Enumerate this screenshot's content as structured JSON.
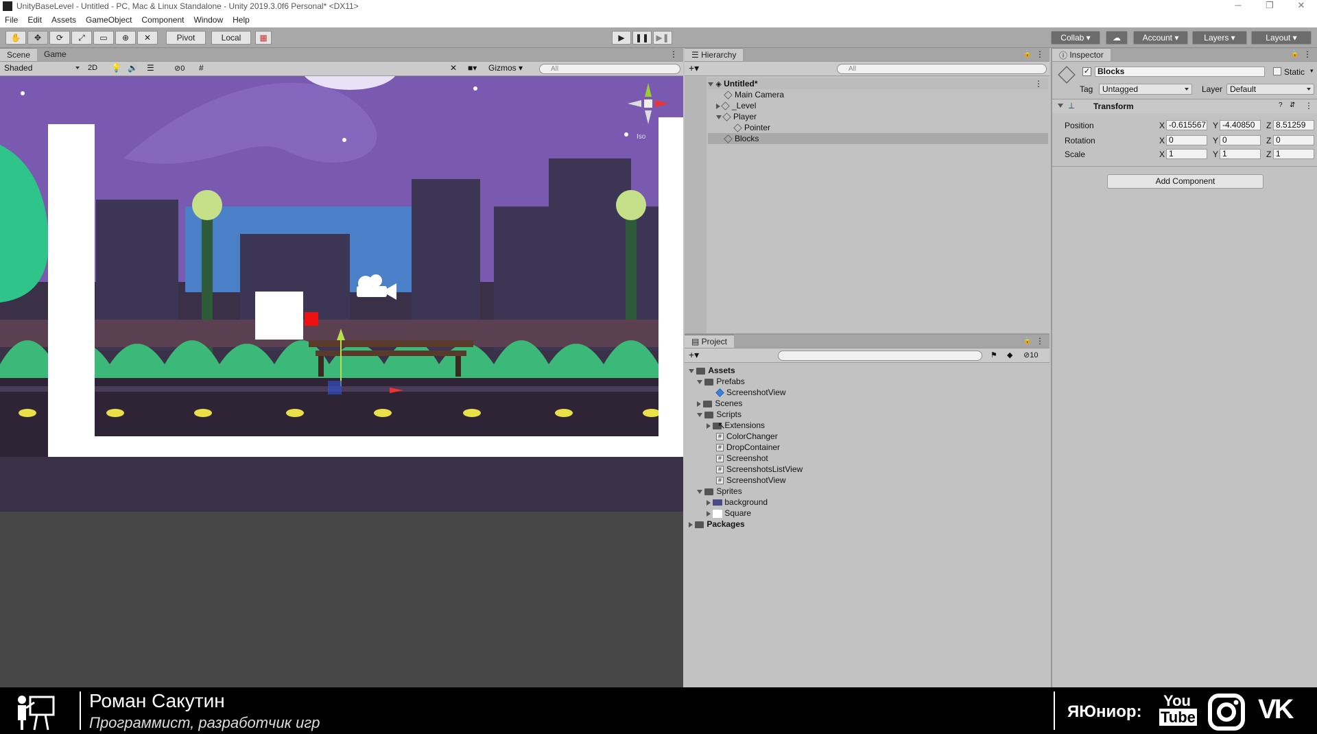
{
  "window": {
    "title": "UnityBaseLevel - Untitled - PC, Mac & Linux Standalone - Unity 2019.3.0f6 Personal* <DX11>",
    "controls": [
      "─",
      "❐",
      "✕"
    ]
  },
  "menu": [
    "File",
    "Edit",
    "Assets",
    "GameObject",
    "Component",
    "Window",
    "Help"
  ],
  "toolbar": {
    "pivot": "Pivot",
    "local": "Local",
    "collab": "Collab",
    "account": "Account",
    "layers": "Layers",
    "layout": "Layout"
  },
  "scene": {
    "tabs": [
      "Scene",
      "Game"
    ],
    "shading": "Shaded",
    "mode_2d": "2D",
    "hidden_count": "0",
    "gizmos": "Gizmos",
    "search_placeholder": "All",
    "orientation": "Iso",
    "colors": {
      "sky": "#7a5ab0",
      "window": "#4a80c8",
      "ground": "#3a3048",
      "grass": "#3cb878"
    }
  },
  "hierarchy": {
    "title": "Hierarchy",
    "search_placeholder": "All",
    "items": [
      {
        "label": "Untitled*",
        "depth": 0,
        "expanded": true,
        "bold": true
      },
      {
        "label": "Main Camera",
        "depth": 1
      },
      {
        "label": "_Level",
        "depth": 1,
        "collapsed": true
      },
      {
        "label": "Player",
        "depth": 1,
        "expanded": true
      },
      {
        "label": "Pointer",
        "depth": 2
      },
      {
        "label": "Blocks",
        "depth": 1,
        "selected": true
      }
    ]
  },
  "project": {
    "title": "Project",
    "hidden_count": "10",
    "items": [
      {
        "label": "Assets",
        "depth": 0,
        "type": "folder",
        "expanded": true,
        "bold": true
      },
      {
        "label": "Prefabs",
        "depth": 1,
        "type": "folder",
        "expanded": true
      },
      {
        "label": "ScreenshotView",
        "depth": 2,
        "type": "prefab"
      },
      {
        "label": "Scenes",
        "depth": 1,
        "type": "folder",
        "collapsed": true
      },
      {
        "label": "Scripts",
        "depth": 1,
        "type": "folder",
        "expanded": true
      },
      {
        "label": "Extensions",
        "depth": 2,
        "type": "folder",
        "collapsed": true
      },
      {
        "label": "ColorChanger",
        "depth": 2,
        "type": "script"
      },
      {
        "label": "DropContainer",
        "depth": 2,
        "type": "script"
      },
      {
        "label": "Screenshot",
        "depth": 2,
        "type": "script"
      },
      {
        "label": "ScreenshotsListView",
        "depth": 2,
        "type": "script"
      },
      {
        "label": "ScreenshotView",
        "depth": 2,
        "type": "script"
      },
      {
        "label": "Sprites",
        "depth": 1,
        "type": "folder",
        "expanded": true
      },
      {
        "label": "background",
        "depth": 2,
        "type": "sprite",
        "collapsed": true
      },
      {
        "label": "Square",
        "depth": 2,
        "type": "sprite",
        "collapsed": true
      },
      {
        "label": "Packages",
        "depth": 0,
        "type": "folder",
        "collapsed": true,
        "bold": true
      }
    ]
  },
  "inspector": {
    "title": "Inspector",
    "object_name": "Blocks",
    "static_label": "Static",
    "tag_label": "Tag",
    "tag_value": "Untagged",
    "layer_label": "Layer",
    "layer_value": "Default",
    "transform_title": "Transform",
    "rows": [
      {
        "label": "Position",
        "x": "-0.615567",
        "y": "-4.40850",
        "z": "8.51259"
      },
      {
        "label": "Rotation",
        "x": "0",
        "y": "0",
        "z": "0"
      },
      {
        "label": "Scale",
        "x": "1",
        "y": "1",
        "z": "1"
      }
    ],
    "axis_labels": [
      "X",
      "Y",
      "Z"
    ],
    "add_component": "Add Component"
  },
  "footer": {
    "name": "Роман Сакутин",
    "subtitle": "Программист, разработчик игр",
    "brand": "ЯЮниор:",
    "social": [
      "YouTube",
      "Instagram",
      "VK"
    ]
  }
}
